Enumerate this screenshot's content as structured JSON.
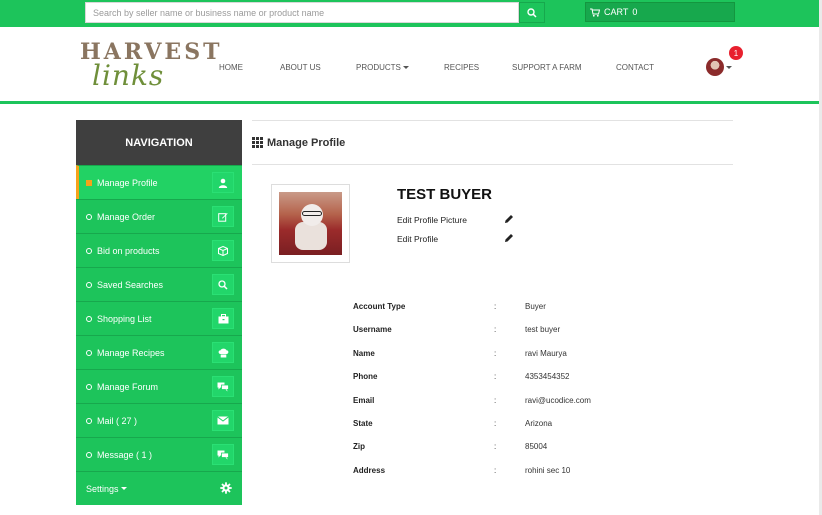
{
  "topbar": {
    "search_placeholder": "Search by seller name or business name or product name",
    "cart_label": "CART",
    "cart_count": "0"
  },
  "header": {
    "logo_top": "HARVEST",
    "logo_bottom": "links",
    "nav": [
      {
        "label": "HOME"
      },
      {
        "label": "ABOUT US"
      },
      {
        "label": "PRODUCTS"
      },
      {
        "label": "RECIPES"
      },
      {
        "label": "SUPPORT A FARM"
      },
      {
        "label": "CONTACT"
      }
    ],
    "notification_count": "1"
  },
  "sidebar": {
    "title": "NAVIGATION",
    "items": [
      {
        "label": "Manage Profile",
        "icon": "user-icon",
        "active": true
      },
      {
        "label": "Manage Order",
        "icon": "edit-icon"
      },
      {
        "label": "Bid on products",
        "icon": "box-icon"
      },
      {
        "label": "Saved Searches",
        "icon": "search-icon"
      },
      {
        "label": "Shopping List",
        "icon": "briefcase-icon"
      },
      {
        "label": "Manage Recipes",
        "icon": "chef-hat-icon"
      },
      {
        "label": "Manage Forum",
        "icon": "comments-icon"
      },
      {
        "label": "Mail ( 27 )",
        "icon": "envelope-icon"
      },
      {
        "label": "Message ( 1 )",
        "icon": "comments-icon"
      }
    ],
    "settings_label": "Settings"
  },
  "main": {
    "title": "Manage Profile",
    "buyer_name": "TEST BUYER",
    "edit_picture_label": "Edit Profile Picture",
    "edit_profile_label": "Edit Profile",
    "details": [
      {
        "label": "Account Type",
        "value": "Buyer"
      },
      {
        "label": "Username",
        "value": "test buyer"
      },
      {
        "label": "Name",
        "value": "ravi Maurya"
      },
      {
        "label": "Phone",
        "value": "4353454352"
      },
      {
        "label": "Email",
        "value": "ravi@ucodice.com"
      },
      {
        "label": "State",
        "value": "Arizona"
      },
      {
        "label": "Zip",
        "value": "85004"
      },
      {
        "label": "Address",
        "value": "rohini sec 10"
      }
    ]
  },
  "colors": {
    "brand_green": "#1dc45b",
    "dark_header": "#3f3f3f",
    "active_marker": "#f5a31a",
    "badge_red": "#e8202e"
  }
}
